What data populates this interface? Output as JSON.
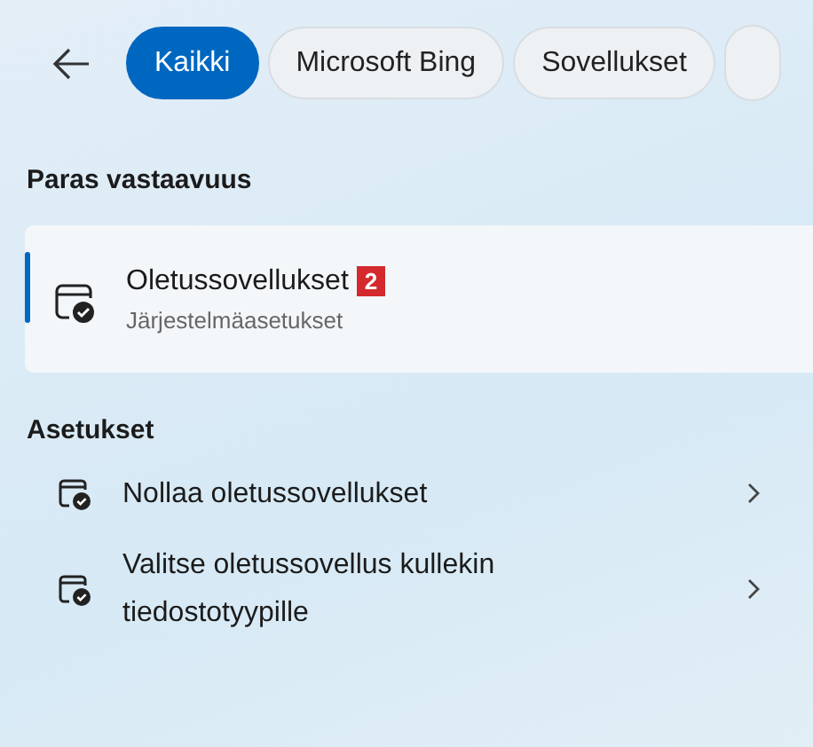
{
  "tabs": [
    {
      "label": "Kaikki",
      "selected": true
    },
    {
      "label": "Microsoft Bing",
      "selected": false
    },
    {
      "label": "Sovellukset",
      "selected": false
    }
  ],
  "best_match": {
    "heading": "Paras vastaavuus",
    "title": "Oletussovellukset",
    "badge": "2",
    "subtitle": "Järjestelmäasetukset",
    "selected": true
  },
  "settings": {
    "heading": "Asetukset",
    "items": [
      {
        "label": "Nollaa oletussovellukset"
      },
      {
        "label": "Valitse oletussovellus kullekin tiedostotyypille"
      }
    ]
  }
}
